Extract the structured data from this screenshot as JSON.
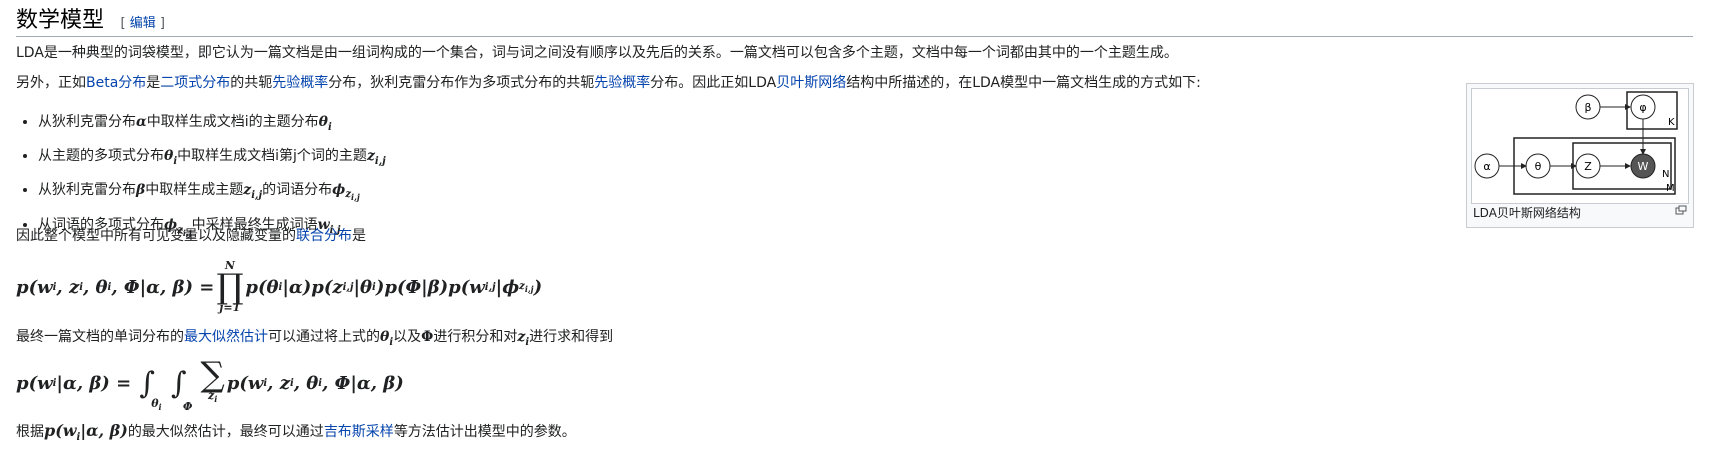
{
  "heading": {
    "title": "数学模型",
    "edit_open": "[",
    "edit_label": "编辑",
    "edit_close": "]"
  },
  "para1": "LDA是一种典型的词袋模型，即它认为一篇文档是由一组词构成的一个集合，词与词之间没有顺序以及先后的关系。一篇文档可以包含多个主题，文档中每一个词都由其中的一个主题生成。",
  "para2": {
    "t1": "另外，正如",
    "l1": "Beta分布",
    "t2": "是",
    "l2": "二项式分布",
    "t3": "的共轭",
    "l3": "先验概率",
    "t4": "分布，狄利克雷分布作为多项式分布的共轭",
    "l4": "先验概率",
    "t5": "分布。因此正如LDA",
    "l5": "贝叶斯网络",
    "t6": "结构中所描述的，在LDA模型中一篇文档生成的方式如下:"
  },
  "bullets": [
    {
      "pre": "从狄利克雷分布",
      "m1": "α",
      "mid": "中取样生成文档i的主题分布",
      "m2": "θ",
      "sub": "i"
    },
    {
      "pre": "从主题的多项式分布",
      "m1": "θ",
      "sub1": "i",
      "mid": "中取样生成文档i第j个词的主题",
      "m2": "z",
      "sub": "i,j"
    },
    {
      "pre": "从狄利克雷分布",
      "m1": "β",
      "mid": "中取样生成主题",
      "m2": "z",
      "sub2": "i,j",
      "post": "的词语分布",
      "m3": "ϕ",
      "sub3": "z",
      "sub3b": "i,j"
    },
    {
      "pre": "从词语的多项式分布",
      "m1": "ϕ",
      "sub1": "z",
      "sub1b": "i,j",
      "mid": "中采样最终生成词语",
      "m2": "w",
      "sub": "i,j"
    }
  ],
  "para3": {
    "t1": "因此整个模型中所有可见变量以及隐藏变量的",
    "l1": "联合分布",
    "t2": "是"
  },
  "formula1": {
    "lhs": "p(w",
    "lhs_sub": "i",
    "lhs_rest": ", z",
    "lhs_sub2": "i",
    "lhs_rest2": ", θ",
    "lhs_sub3": "i",
    "lhs_rest3": ", Φ|α, β) =",
    "prod": "∏",
    "upper": "N",
    "lower": "j=1",
    "rhs1": "p(θ",
    "rhs1_sub": "i",
    "rhs1b": "|α)p(z",
    "rhs1_sub2": "i,j",
    "rhs1c": "|θ",
    "rhs1_sub3": "i",
    "rhs1d": ")p(Φ|β)p(w",
    "rhs1_sub4": "i,j",
    "rhs1e": "|ϕ",
    "rhs1_sub5": "z",
    "rhs1_sub5b": "i,j",
    "rhs1f": ")"
  },
  "para4": {
    "t1": "最终一篇文档的单词分布的",
    "l1": "最大似然估计",
    "t2": "可以通过将上式的",
    "m1": "θ",
    "s1": "i",
    "t3": "以及",
    "m2": "Φ",
    "t4": "进行积分和对",
    "m3": "z",
    "s3": "i",
    "t5": "进行求和得到"
  },
  "formula2": {
    "lhs": "p(w",
    "lhs_sub": "i",
    "lhs_rest": "|α, β) =",
    "int": "∫",
    "int1_lim": "θ",
    "int1_lim_sub": "i",
    "int2_lim": "Φ",
    "sum": "∑",
    "sum_lim": "z",
    "sum_lim_sub": "i",
    "rhs": "p(w",
    "rhs_sub": "i",
    "rhs_b": ", z",
    "rhs_sub2": "i",
    "rhs_c": ", θ",
    "rhs_sub3": "i",
    "rhs_d": ", Φ|α, β)"
  },
  "para5": {
    "t1": "根据",
    "m1": "p(w",
    "s1": "i",
    "m1b": "|α, β)",
    "t2": "的最大似然估计，最终可以通过",
    "l1": "吉布斯采样",
    "t3": "等方法估计出模型中的参数。"
  },
  "figure": {
    "caption": "LDA贝叶斯网络结构",
    "nodes": {
      "beta": "β",
      "phi": "φ",
      "alpha": "α",
      "theta": "θ",
      "z": "Z",
      "w": "W"
    },
    "plates": {
      "k": "K",
      "n": "N",
      "m": "M"
    }
  }
}
